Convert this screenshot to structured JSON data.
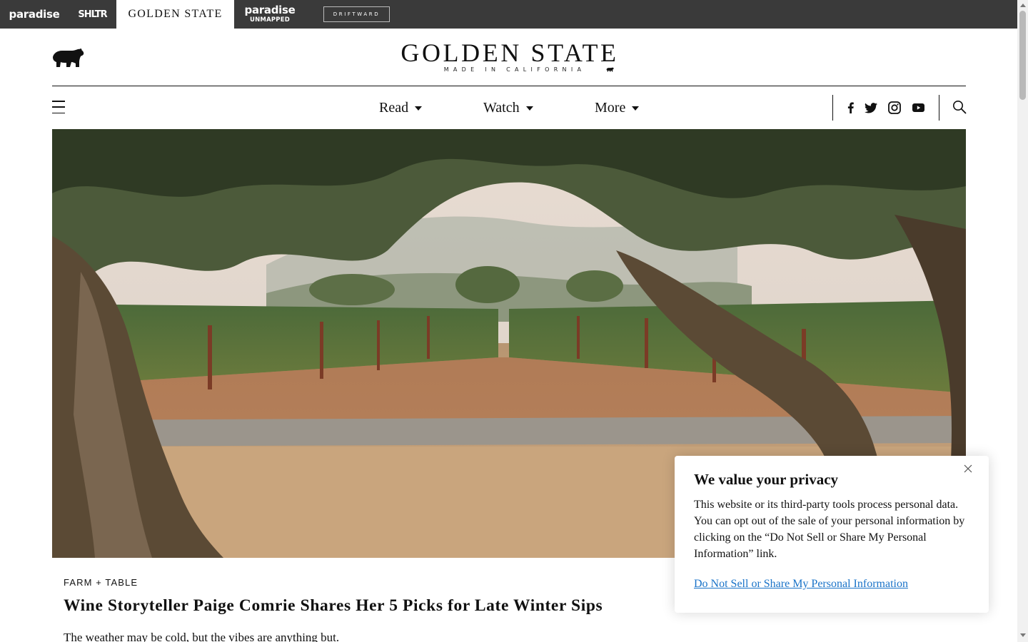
{
  "network_bar": {
    "items": [
      {
        "label": "paradise"
      },
      {
        "label": "SHLTR"
      },
      {
        "label": "GOLDEN STATE",
        "active": true
      },
      {
        "label": "paradise",
        "sublabel": "UNMAPPED"
      },
      {
        "label": "DRIFTWARD"
      }
    ]
  },
  "header": {
    "logo_title": "GOLDEN STATE",
    "logo_subtitle": "MADE IN CALIFORNIA",
    "bear_icon": "bear-icon"
  },
  "nav": {
    "menu_icon": "hamburger-menu-icon",
    "items": [
      {
        "label": "Read"
      },
      {
        "label": "Watch"
      },
      {
        "label": "More"
      }
    ],
    "social": [
      "facebook-icon",
      "twitter-icon",
      "instagram-icon",
      "youtube-icon"
    ],
    "search_icon": "search-icon"
  },
  "article": {
    "category": "FARM + TABLE",
    "headline": "Wine Storyteller Paige Comrie Shares Her 5 Picks for Late Winter Sips",
    "dek": "The weather may be cold, but the vibes are anything but."
  },
  "privacy": {
    "title": "We value your privacy",
    "body": "This website or its third-party tools process personal data. You can opt out of the sale of your personal information by clicking on the “Do Not Sell or Share My Personal Information” link.",
    "link": "Do Not Sell or Share My Personal Information",
    "close_icon": "close-icon"
  },
  "colors": {
    "network_bar_bg": "#3a3a3a",
    "link_blue": "#1a73c8",
    "text": "#111111"
  }
}
